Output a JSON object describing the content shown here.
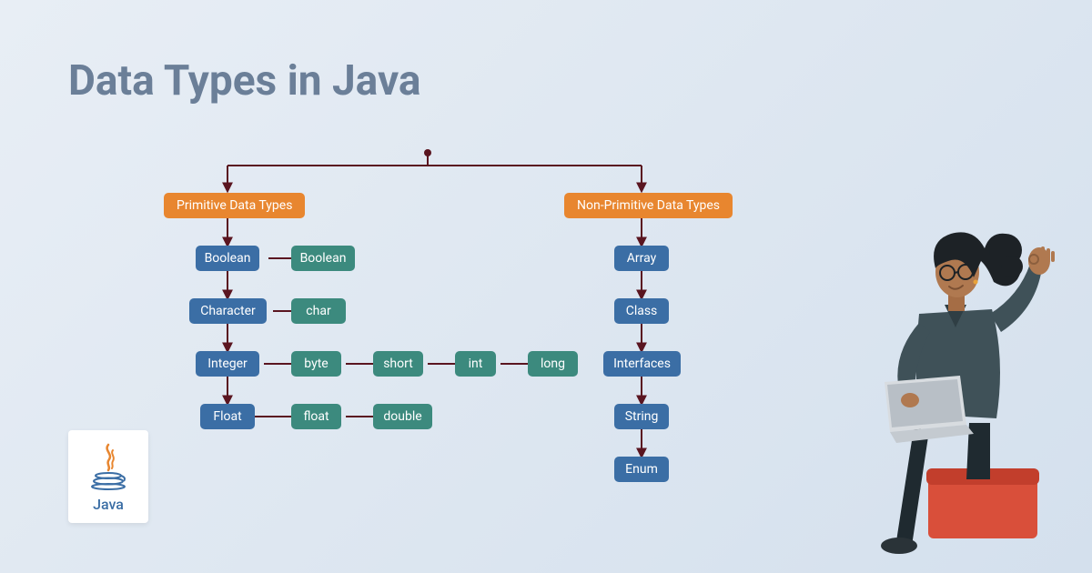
{
  "title": "Data Types in Java",
  "diagram": {
    "primitive": {
      "label": "Primitive Data Types",
      "children": [
        {
          "label": "Boolean",
          "subtypes": [
            "Boolean"
          ]
        },
        {
          "label": "Character",
          "subtypes": [
            "char"
          ]
        },
        {
          "label": "Integer",
          "subtypes": [
            "byte",
            "short",
            "int",
            "long"
          ]
        },
        {
          "label": "Float",
          "subtypes": [
            "float",
            "double"
          ]
        }
      ]
    },
    "nonprimitive": {
      "label": "Non-Primitive Data Types",
      "children": [
        "Array",
        "Class",
        "Interfaces",
        "String",
        "Enum"
      ]
    }
  },
  "logo": {
    "text": "Java"
  },
  "colors": {
    "orange": "#e8862f",
    "blue": "#3b6ea5",
    "teal": "#3c8a7e",
    "line": "#5a1520"
  }
}
